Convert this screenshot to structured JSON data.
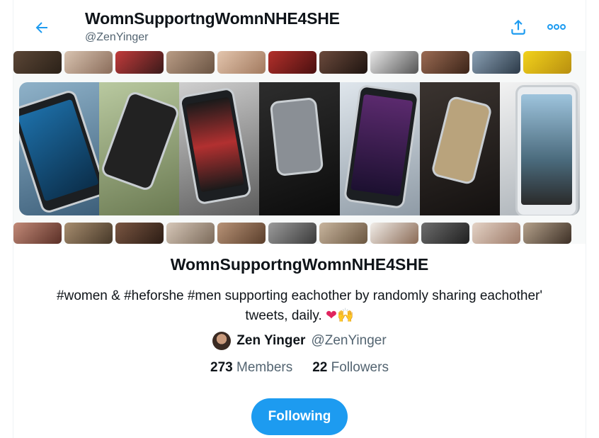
{
  "header": {
    "list_name": "WomnSupportngWomnNHE4SHE",
    "list_handle": "@ZenYinger",
    "back_icon": "arrow-left-icon",
    "share_icon": "share-icon",
    "more_icon": "more-horizontal-icon"
  },
  "info": {
    "name": "WomnSupportngWomnNHE4SHE",
    "description_line1": "#women & #heforshe #men supporting eachother by randomly sharing eachother'",
    "description_line2": "tweets, daily.",
    "emoji_heart": "❤",
    "emoji_hands": "🙌",
    "owner": {
      "name": "Zen Yinger",
      "handle": "@ZenYinger"
    },
    "stats": {
      "members_count": "273",
      "members_label": "Members",
      "followers_count": "22",
      "followers_label": "Followers"
    },
    "following_button": "Following"
  },
  "colors": {
    "accent": "#1d9bf0",
    "text_primary": "#0f1419",
    "text_secondary": "#536471"
  }
}
